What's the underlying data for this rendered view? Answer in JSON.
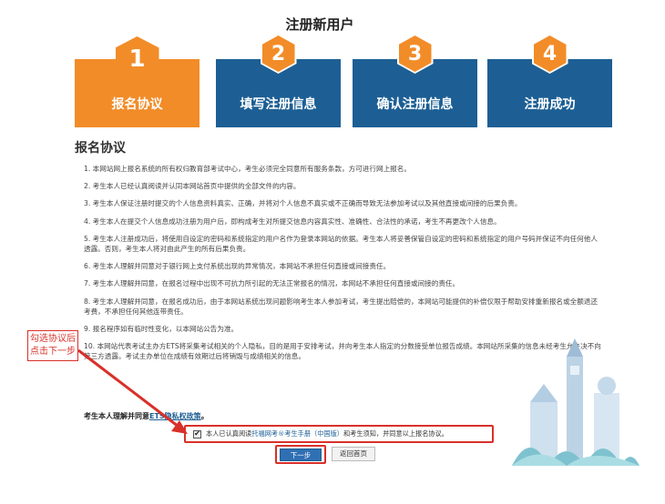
{
  "page": {
    "title": "注册新用户"
  },
  "steps": [
    {
      "number": "1",
      "label": "报名协议"
    },
    {
      "number": "2",
      "label": "填写注册信息"
    },
    {
      "number": "3",
      "label": "确认注册信息"
    },
    {
      "number": "4",
      "label": "注册成功"
    }
  ],
  "section": {
    "title": "报名协议"
  },
  "terms": [
    "1. 本网站网上报名系统的所有权归教育部考试中心，考生必须完全同意所有服务条款，方可进行网上报名。",
    "2. 考生本人已经认真阅读并认同本网站首页中提供的全部文件的内容。",
    "3. 考生本人保证注册时提交的个人信息资料真实、正确，并将对个人信息不真实或不正确而导致无法参加考试以及其他直接或间接的后果负责。",
    "4. 考生本人在提交个人信息成功注册为用户后，即构成考生对所提交信息内容真实性、准确性、合法性的承诺，考生不再更改个人信息。",
    "5. 考生本人注册成功后，将使用自设定的密码和系统指定的用户名作为登录本网站的依据。考生本人将妥善保管自设定的密码和系统指定的用户号码并保证不向任何他人透露。否则，考生本人将对由此产生的所有后果负责。",
    "6. 考生本人理解并同意对于银行网上支付系统出现的异常情况，本网站不承担任何直接或间接责任。",
    "7. 考生本人理解并同意，在报名过程中出现不可抗力所引起的无法正常报名的情况，本网站不承担任何直接或间接的责任。",
    "8. 考生本人理解并同意，在报名成功后，由于本网站系统出现问题影响考生本人参加考试，考生提出赔偿的，本网站可能提供的补偿仅限于帮助安排重新报名或全额退还考费，不承担任何其他连带责任。",
    "9. 报名程序如有临时性变化，以本网站公告为准。",
    "10. 本网站代表考试主办方ETS将采集考试相关的个人隐私，目的是用于安排考试，并向考生本人指定的分数接受单位报告成绩。本网站所采集的信息未经考生允许决不向第三方透露。考试主办单位在成绩有效期过后将销毁与成绩相关的信息。"
  ],
  "privacy": {
    "prefix": "考生本人理解并同意",
    "link": "ETS隐私权政策",
    "suffix": "。"
  },
  "agreement": {
    "checkbox_mark": "✔",
    "text_before": "本人已认真阅读",
    "link": "托福网考®考生手册（中国版）",
    "text_after": "和考生须知，并同意以上报名协议。"
  },
  "buttons": {
    "next": "下一步",
    "back": "返回首页"
  },
  "annotation": {
    "line1": "勾选协议后",
    "line2": "点击下一步"
  },
  "colors": {
    "orange": "#f28c28",
    "blue": "#1d5f94",
    "red": "#d9302a"
  }
}
